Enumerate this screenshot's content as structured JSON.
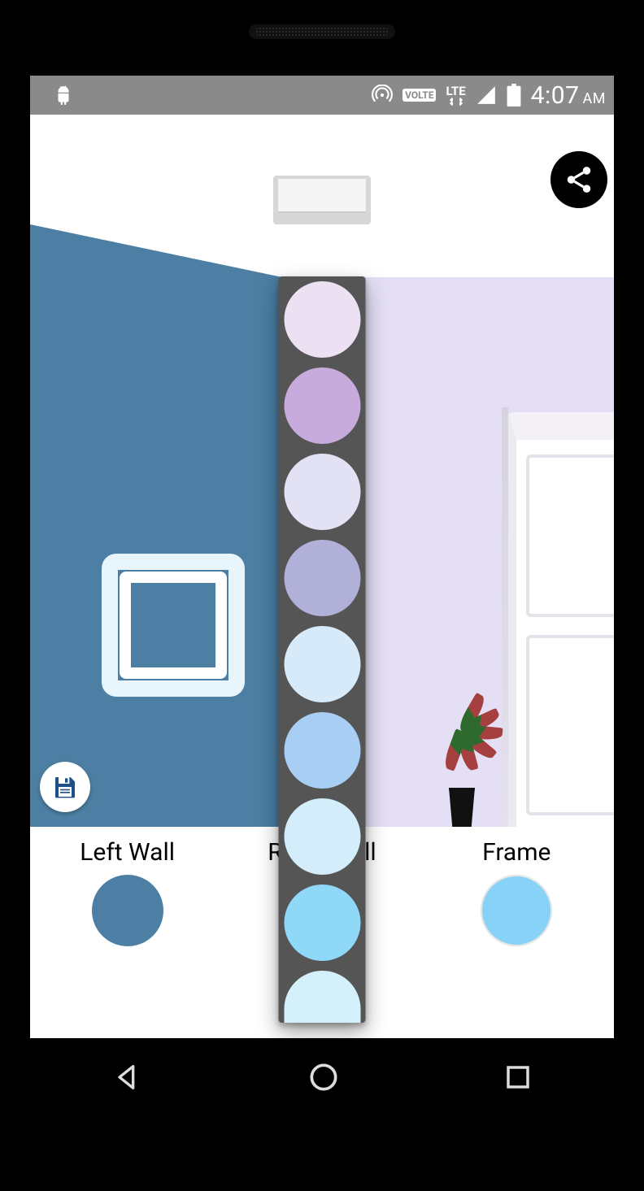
{
  "status_bar": {
    "volte": "VOLTE",
    "network": "LTE",
    "time": "4:07",
    "ampm": "AM"
  },
  "room": {
    "left_wall_color": "#4c7fa3",
    "right_wall_color": "#e5dff5",
    "frame_border_color": "#e9f5fc"
  },
  "slots": {
    "left_label": "Left Wall",
    "right_label": "Right Wall",
    "frame_label": "Frame",
    "left_color": "#4c7fa3",
    "frame_color": "#88d2f7"
  },
  "palette_colors": [
    "#ece1f3",
    "#c6abdc",
    "#e3e2f4",
    "#b0b0d8",
    "#d7eafa",
    "#a8cff3",
    "#d4edfb",
    "#90d8f7",
    "#d3f0fb"
  ],
  "icons": {
    "share": "share-icon",
    "save": "save-icon",
    "android": "android-icon",
    "hotspot": "hotspot-icon",
    "lte": "lte-icon",
    "signal": "signal-icon",
    "battery": "battery-icon",
    "nav_back": "nav-back-icon",
    "nav_home": "nav-home-icon",
    "nav_recent": "nav-recent-icon"
  }
}
